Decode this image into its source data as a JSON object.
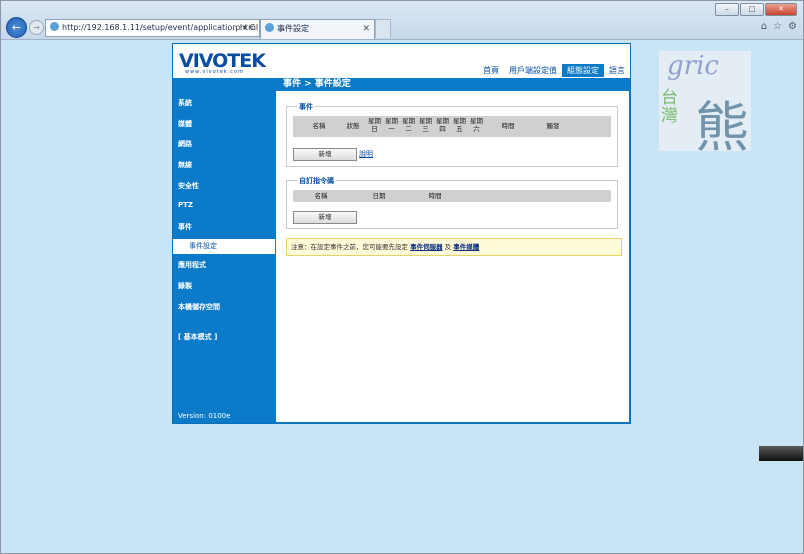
{
  "browser": {
    "url": "http://192.168.1.11/setup/event/application.html",
    "address_controls": "ρ ▾ C",
    "tab_title": "事件設定",
    "tab_close": "✕",
    "win_min": "–",
    "win_max": "□",
    "win_close": "✕",
    "back": "←",
    "fwd": "→",
    "tools": [
      "⌂",
      "☆",
      "⚙"
    ]
  },
  "header": {
    "logo": "VIVOTEK",
    "logo_sub": "www.vivotek.com",
    "nav": [
      "首頁",
      "用戶端設定值",
      "組態設定",
      "語言"
    ],
    "active_nav": "組態設定"
  },
  "page_title": "事件 > 事件設定",
  "sidebar": {
    "items": [
      "系統",
      "媒體",
      "網路",
      "無線",
      "安全性",
      "PTZ",
      "事件"
    ],
    "sub_item": "事件設定",
    "items2": [
      "應用程式",
      "錄製",
      "本機儲存空間"
    ],
    "basic_mode": "[ 基本模式 ]",
    "version": "Version: 0100e"
  },
  "event_section": {
    "legend": "事件",
    "columns": [
      "名稱",
      "狀態",
      "星期\n日",
      "星期\n一",
      "星期\n二",
      "星期\n三",
      "星期\n四",
      "星期\n五",
      "星期\n六",
      "時間",
      "觸發"
    ],
    "add_button": "新增",
    "help_link": "說明"
  },
  "cmd_section": {
    "legend": "自訂指令碼",
    "columns": [
      "名稱",
      "日期",
      "時間"
    ],
    "add_button": "新增"
  },
  "notice": {
    "prefix": "注意：在設定事件之前，您可能要先設定",
    "link1": "事件伺服器",
    "mid": "及",
    "link2": "事件媒體"
  },
  "watermark": {
    "word": "gric",
    "small_chars": "台灣",
    "big_char": "熊"
  }
}
